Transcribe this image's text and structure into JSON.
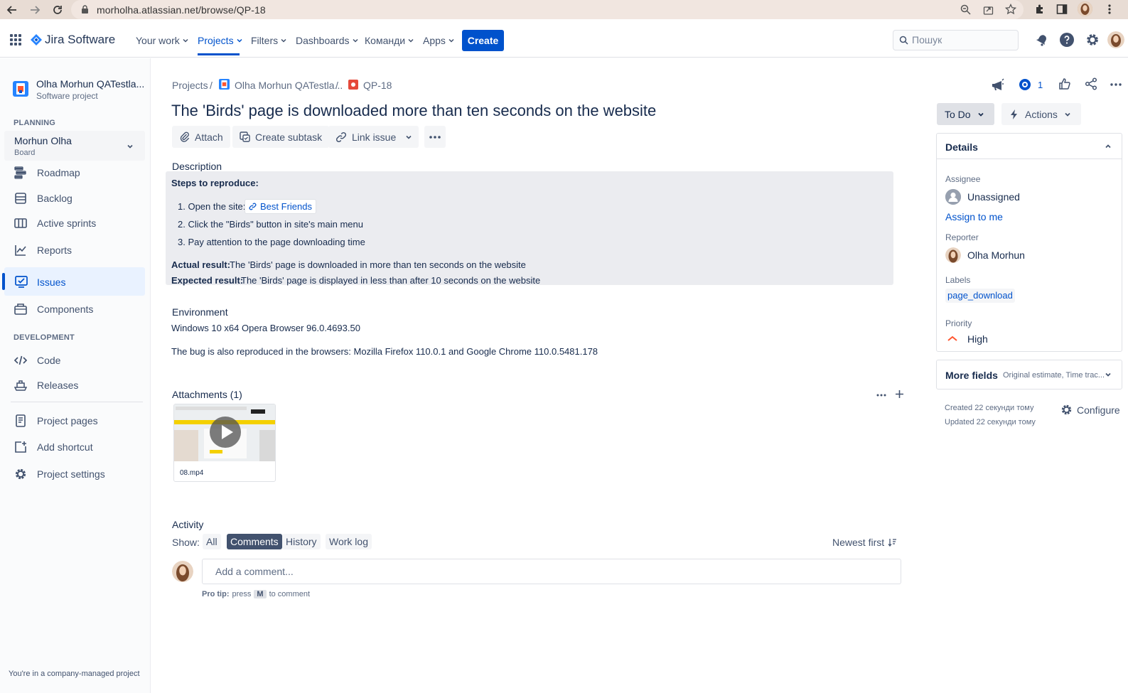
{
  "browser": {
    "url": "morholha.atlassian.net/browse/QP-18"
  },
  "topnav": {
    "product": "Jira Software",
    "items": [
      "Your work",
      "Projects",
      "Filters",
      "Dashboards",
      "Команди",
      "Apps"
    ],
    "create": "Create",
    "search_placeholder": "Пошук"
  },
  "sidebar": {
    "project_name": "Olha Morhun QATestla...",
    "project_type": "Software project",
    "planning_title": "PLANNING",
    "board_name": "Morhun Olha",
    "board_sub": "Board",
    "planning_items": [
      "Roadmap",
      "Backlog",
      "Active sprints",
      "Reports",
      "Issues",
      "Components"
    ],
    "development_title": "DEVELOPMENT",
    "dev_items": [
      "Code",
      "Releases"
    ],
    "bottom_items": [
      "Project pages",
      "Add shortcut",
      "Project settings"
    ],
    "footer": "You're in a company-managed project"
  },
  "breadcrumb": {
    "root": "Projects",
    "project": "Olha Morhun QATestla...",
    "issue": "QP-18"
  },
  "issue": {
    "title": "The 'Birds' page is downloaded more than ten seconds on the website",
    "actions": {
      "attach": "Attach",
      "subtask": "Create subtask",
      "link": "Link issue"
    },
    "description_label": "Description",
    "steps_title": "Steps to reproduce:",
    "steps": [
      "1. Open the site:",
      "2. Click the \"Birds\" button in site's main menu",
      "3. Pay attention to the page downloading time"
    ],
    "site_link": "Best Friends",
    "actual_label": "Actual result:",
    "actual": "The 'Birds' page is downloaded in more than ten seconds on the website",
    "expected_label": "Expected result:",
    "expected": "The 'Birds' page is displayed in less than after 10 seconds on the website",
    "environment_label": "Environment",
    "environment_1": "Windows 10 x64 Opera Browser 96.0.4693.50",
    "environment_2": "The bug is also reproduced in the browsers: Mozilla Firefox 110.0.1 and Google Chrome 110.0.5481.178",
    "attachments_label": "Attachments (1)",
    "attachment_name": "08.mp4"
  },
  "activity": {
    "label": "Activity",
    "show": "Show:",
    "filters": [
      "All",
      "Comments",
      "History",
      "Work log"
    ],
    "selected": "Comments",
    "sort": "Newest first",
    "comment_placeholder": "Add a comment...",
    "protip_bold": "Pro tip:",
    "protip_press": "press",
    "protip_key": "M",
    "protip_rest": "to comment"
  },
  "right": {
    "watch_count": "1",
    "status": "To Do",
    "actions": "Actions",
    "details": "Details",
    "assignee_label": "Assignee",
    "assignee": "Unassigned",
    "assign_me": "Assign to me",
    "reporter_label": "Reporter",
    "reporter": "Olha Morhun",
    "labels_label": "Labels",
    "label_value": "page_download",
    "priority_label": "Priority",
    "priority": "High",
    "more_fields": "More fields",
    "more_fields_hint": "Original estimate, Time trac...",
    "created": "Created 22 секунди тому",
    "updated": "Updated 22 секунди тому",
    "configure": "Configure"
  },
  "colors": {
    "brand": "#0052cc",
    "priority_high": "#ff5630",
    "bug": "#e5493a"
  }
}
